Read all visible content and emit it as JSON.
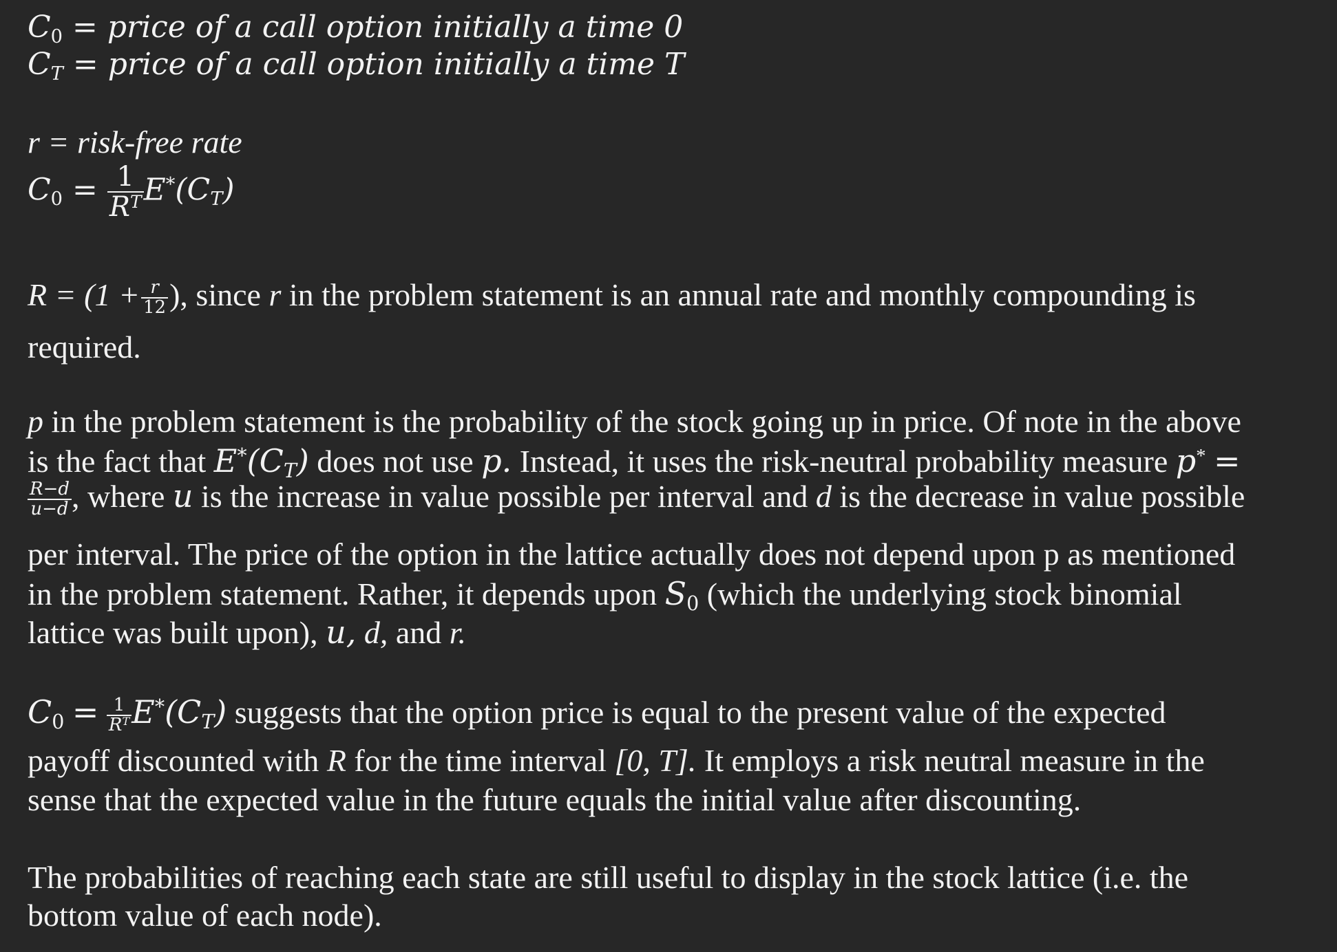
{
  "defs": {
    "c0_symbol": "C",
    "c0_sub": "0",
    "c0_text": "= price of a call option initially a time 0",
    "ct_symbol": "C",
    "ct_sub": "T",
    "ct_text": "= price of a call option initially a time T",
    "r_def": "r = risk-free rate"
  },
  "formula": {
    "lhs": "C",
    "lhs_sub": "0",
    "eq": "=",
    "num": "1",
    "den": "R",
    "den_sup": "T",
    "expect": "E",
    "star": "*",
    "arg": "(C",
    "arg_sub": "T",
    "arg_close": ")"
  },
  "para_r": {
    "lead": "R = (1 +",
    "frac_num": "r",
    "frac_den": "12",
    "tail": "), since",
    "r": "r",
    "tail2": "in the problem statement is an annual rate and monthly compounding is",
    "line2": "required."
  },
  "para_p": {
    "l1_p": "p",
    "l1_rest": "in the problem statement is the probability of the stock going up in price.  Of note in the above",
    "l2_a": "is the fact that",
    "l2_E": "E",
    "l2_star": "*",
    "l2_arg": "(C",
    "l2_sub": "T",
    "l2_close": ")",
    "l2_b": "does not use",
    "l2_p": "p.",
    "l2_c": "Instead, it uses the risk-neutral probability measure",
    "l2_pstar": "p",
    "l2_pstar_sup": "*",
    "l2_eq": "=",
    "l3_num": "R−d",
    "l3_den": "u−d",
    "l3_comma": ",",
    "l3_a": "where",
    "l3_u": "u",
    "l3_b": "is the increase in value possible per interval and",
    "l3_d": "d",
    "l3_c": "is the decrease in value possible",
    "l4": "per interval.   The price of the option in the lattice actually does not depend upon p as mentioned",
    "l5_a": "in the problem statement.  Rather, it depends upon",
    "l5_S": "S",
    "l5_sub": "0",
    "l5_b": "(which the underlying stock binomial",
    "l6_a": "lattice was built upon),",
    "l6_u": "u,",
    "l6_d": "d,",
    "l6_b": "and",
    "l6_r": "r."
  },
  "para_c0": {
    "lhs": "C",
    "lhs_sub": "0",
    "eq": "=",
    "num": "1",
    "den": "R",
    "den_sup": "T",
    "expect": "E",
    "star": "*",
    "arg": "(C",
    "arg_sub": "T",
    "arg_close": ")",
    "l1_rest": "suggests that the option price is equal to the present value of the expected",
    "l2_a": "payoff discounted with",
    "l2_R": "R",
    "l2_b": "for the time interval",
    "l2_interval": "[0, T].",
    "l2_c": "It employs a risk neutral measure in the",
    "l3": "sense that the expected value in the future equals the initial value after discounting."
  },
  "para_prob": {
    "l1": "The probabilities of reaching each state are still useful to display in the stock lattice (i.e. the",
    "l2": "bottom value of each node)."
  }
}
